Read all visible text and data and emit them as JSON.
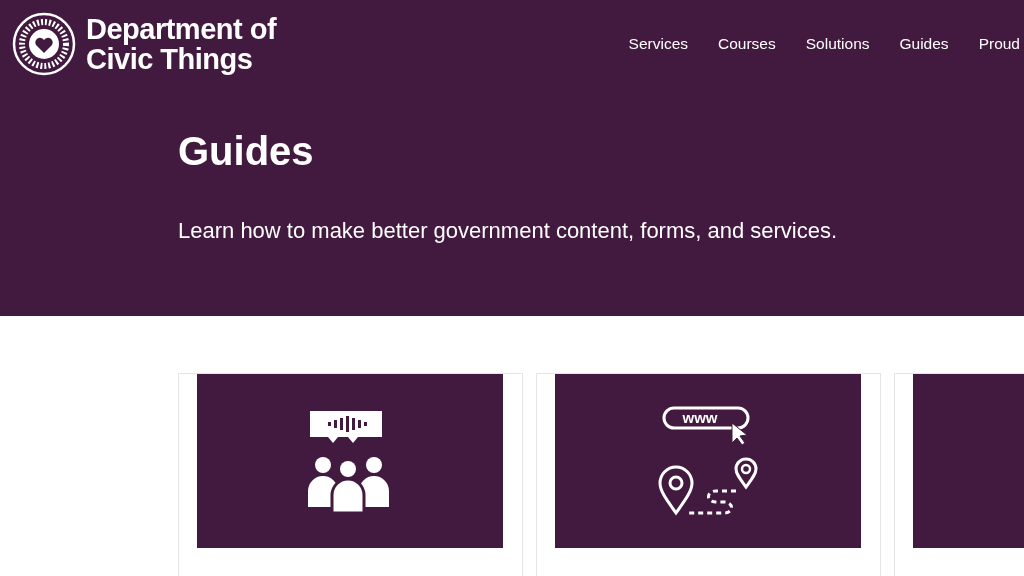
{
  "header": {
    "logo_lines": [
      "Department of",
      "Civic Things"
    ],
    "nav": [
      {
        "label": "Services"
      },
      {
        "label": "Courses"
      },
      {
        "label": "Solutions"
      },
      {
        "label": "Guides"
      },
      {
        "label": "Proud"
      }
    ]
  },
  "hero": {
    "title": "Guides",
    "subtitle": "Learn how to make better government content, forms, and services."
  },
  "cards": [
    {
      "kind": "audience"
    },
    {
      "kind": "web",
      "url_text": "www"
    },
    {
      "kind": "blank"
    }
  ]
}
